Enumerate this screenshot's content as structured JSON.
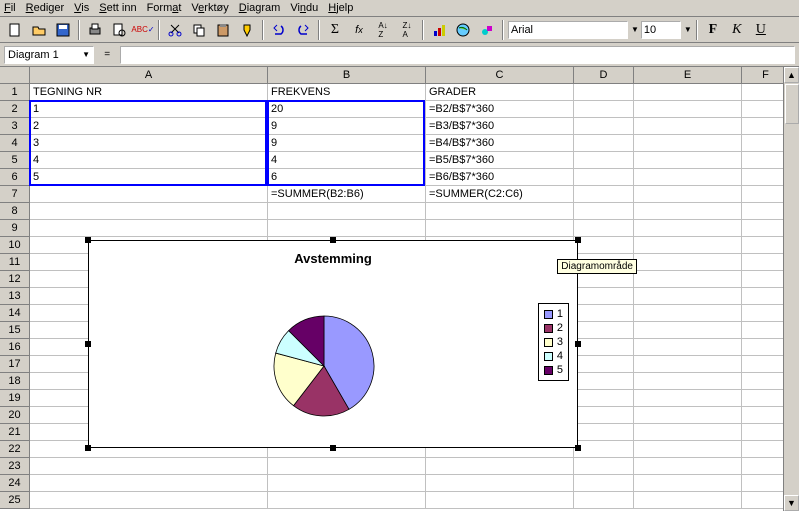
{
  "menus": {
    "fil": "Fil",
    "rediger": "Rediger",
    "vis": "Vis",
    "settinn": "Sett inn",
    "format": "Format",
    "verktoy": "Verktøy",
    "diagram": "Diagram",
    "vindu": "Vindu",
    "hjelp": "Hjelp"
  },
  "toolbar": {
    "font": "Arial",
    "size": "10",
    "bold": "F",
    "italic": "K",
    "underline": "U"
  },
  "formula_bar": {
    "name_box": "Diagram 1",
    "equals": "="
  },
  "columns": [
    "A",
    "B",
    "C",
    "D",
    "E",
    "F"
  ],
  "rows_visible": 25,
  "grid": {
    "r1": {
      "A": "TEGNING NR",
      "B": "FREKVENS",
      "C": "GRADER"
    },
    "r2": {
      "A": "1",
      "B": "20",
      "C": "=B2/B$7*360"
    },
    "r3": {
      "A": "2",
      "B": "9",
      "C": "=B3/B$7*360"
    },
    "r4": {
      "A": "3",
      "B": "9",
      "C": "=B4/B$7*360"
    },
    "r5": {
      "A": "4",
      "B": "4",
      "C": "=B5/B$7*360"
    },
    "r6": {
      "A": "5",
      "B": "6",
      "C": "=B6/B$7*360"
    },
    "r7": {
      "A": "",
      "B": "=SUMMER(B2:B6)",
      "C": "=SUMMER(C2:C6)"
    }
  },
  "chart": {
    "title": "Avstemming",
    "tooltip": "Diagramområde",
    "legend": [
      "1",
      "2",
      "3",
      "4",
      "5"
    ],
    "colors": {
      "1": "#9999ff",
      "2": "#993366",
      "3": "#ffffcc",
      "4": "#ccffff",
      "5": "#660066"
    }
  },
  "chart_data": {
    "type": "pie",
    "title": "Avstemming",
    "categories": [
      "1",
      "2",
      "3",
      "4",
      "5"
    ],
    "values": [
      20,
      9,
      9,
      4,
      6
    ],
    "series_name": "FREKVENS"
  }
}
